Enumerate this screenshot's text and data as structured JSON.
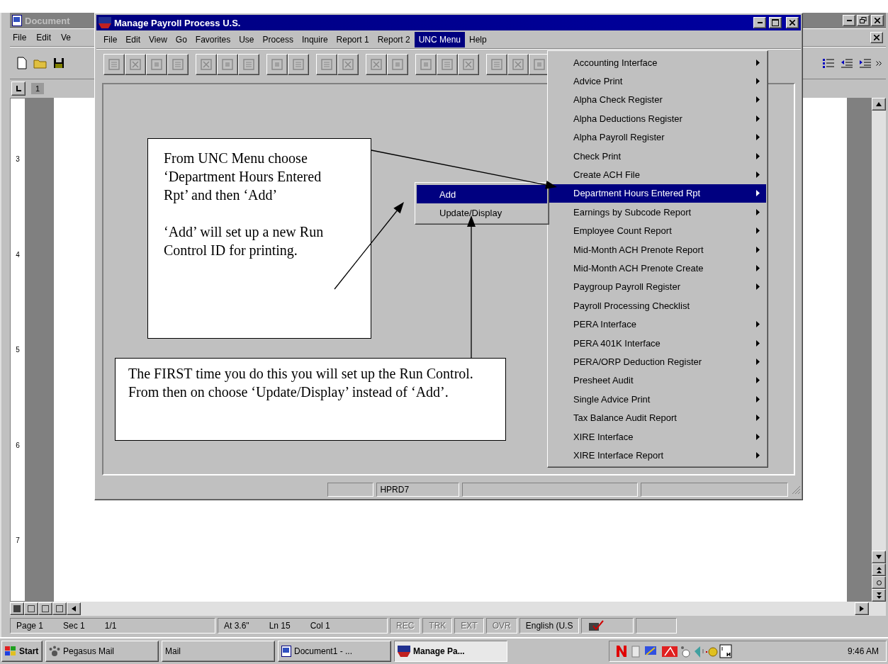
{
  "word": {
    "title": "Document",
    "menu": [
      "File",
      "Edit",
      "Ve"
    ],
    "ruler": {
      "top_number": "1",
      "side_numbers": [
        "3",
        "4",
        "5",
        "6",
        "7"
      ]
    },
    "status_bar": {
      "groups": [
        [
          "Page 1",
          "Sec 1",
          "1/1"
        ],
        [
          "At 3.6\"",
          "Ln 15",
          "Col 1"
        ]
      ],
      "indicators": [
        {
          "text": "REC",
          "disabled": true
        },
        {
          "text": "TRK",
          "disabled": true
        },
        {
          "text": "EXT",
          "disabled": true
        },
        {
          "text": "OVR",
          "disabled": true
        },
        {
          "text": "English (U.S",
          "disabled": false
        }
      ]
    }
  },
  "payroll": {
    "title": "Manage Payroll Process U.S.",
    "menu": [
      {
        "label": "File",
        "selected": false
      },
      {
        "label": "Edit",
        "selected": false
      },
      {
        "label": "View",
        "selected": false
      },
      {
        "label": "Go",
        "selected": false
      },
      {
        "label": "Favorites",
        "selected": false
      },
      {
        "label": "Use",
        "selected": false
      },
      {
        "label": "Process",
        "selected": false
      },
      {
        "label": "Inquire",
        "selected": false
      },
      {
        "label": "Report 1",
        "selected": false
      },
      {
        "label": "Report 2",
        "selected": false
      },
      {
        "label": "UNC Menu",
        "selected": true
      },
      {
        "label": "Help",
        "selected": false
      }
    ],
    "status_bar": {
      "database": "HPRD7"
    },
    "unc_menu": [
      {
        "label": "Accounting Interface",
        "submenu": true,
        "selected": false
      },
      {
        "label": "Advice Print",
        "submenu": true,
        "selected": false
      },
      {
        "label": "Alpha Check Register",
        "submenu": true,
        "selected": false
      },
      {
        "label": "Alpha Deductions Register",
        "submenu": true,
        "selected": false
      },
      {
        "label": "Alpha Payroll Register",
        "submenu": true,
        "selected": false
      },
      {
        "label": "Check Print",
        "submenu": true,
        "selected": false
      },
      {
        "label": "Create ACH File",
        "submenu": true,
        "selected": false
      },
      {
        "label": "Department Hours Entered Rpt",
        "submenu": true,
        "selected": true
      },
      {
        "label": "Earnings by Subcode Report",
        "submenu": true,
        "selected": false
      },
      {
        "label": "Employee Count Report",
        "submenu": true,
        "selected": false
      },
      {
        "label": "Mid-Month ACH Prenote Report",
        "submenu": true,
        "selected": false
      },
      {
        "label": "Mid-Month ACH Prenote Create",
        "submenu": true,
        "selected": false
      },
      {
        "label": "Paygroup Payroll Register",
        "submenu": true,
        "selected": false
      },
      {
        "label": "Payroll Processing Checklist",
        "submenu": false,
        "selected": false
      },
      {
        "label": "PERA Interface",
        "submenu": true,
        "selected": false
      },
      {
        "label": "PERA 401K Interface",
        "submenu": true,
        "selected": false
      },
      {
        "label": "PERA/ORP Deduction Register",
        "submenu": true,
        "selected": false
      },
      {
        "label": "Presheet Audit",
        "submenu": true,
        "selected": false
      },
      {
        "label": "Single Advice Print",
        "submenu": true,
        "selected": false
      },
      {
        "label": "Tax Balance Audit Report",
        "submenu": true,
        "selected": false
      },
      {
        "label": "XIRE Interface",
        "submenu": true,
        "selected": false
      },
      {
        "label": "XIRE Interface Report",
        "submenu": true,
        "selected": false
      }
    ],
    "submenu": [
      {
        "label": "Add",
        "selected": true
      },
      {
        "label": "Update/Display",
        "selected": false
      }
    ]
  },
  "callouts": [
    {
      "paragraphs": [
        "From UNC Menu choose ‘Department Hours Entered Rpt’ and then ‘Add’",
        "‘Add’ will set up a new Run Control ID for printing."
      ]
    },
    {
      "paragraphs": [
        "The FIRST time you do this you will set up the Run Control.  From then on choose ‘Update/Display’ instead of ‘Add’."
      ]
    }
  ],
  "taskbar": {
    "start": "Start",
    "buttons": [
      {
        "label": "Pegasus Mail",
        "selected": false
      },
      {
        "label": "Mail",
        "selected": false
      },
      {
        "label": "Document1 - ...",
        "selected": false
      },
      {
        "label": "Manage Pa...",
        "selected": true
      }
    ],
    "clock": "9:46 AM"
  }
}
